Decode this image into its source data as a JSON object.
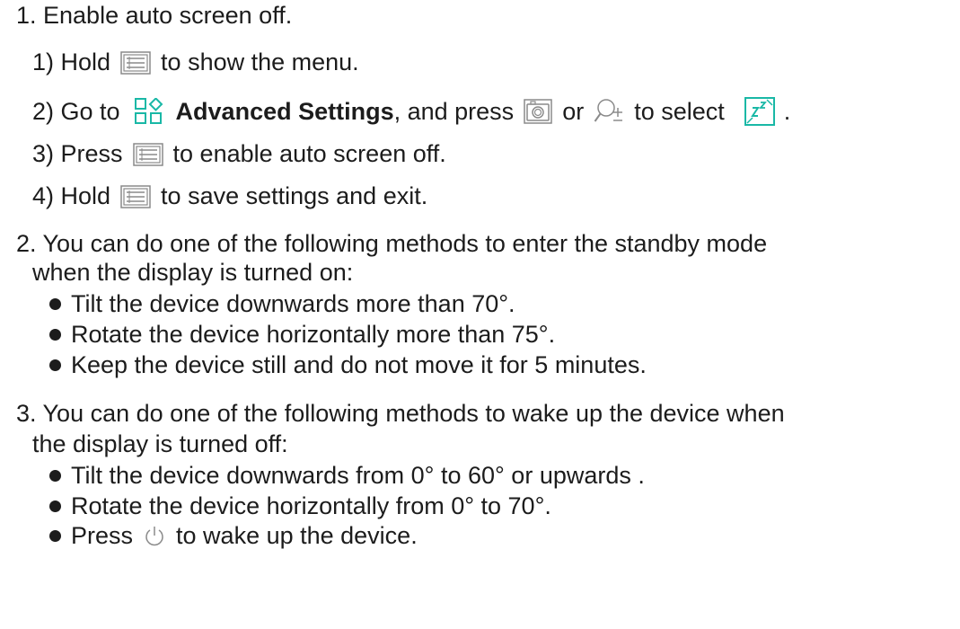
{
  "steps": [
    {
      "label": "1. Enable auto screen off.",
      "substeps": [
        {
          "prefix": "1) Hold",
          "icon": "menu-button-icon",
          "suffix": "to show the menu."
        },
        {
          "prefix": "2) Go to",
          "icon1": "advanced-settings-icon",
          "bold": "Advanced Settings",
          "mid1": ", and press",
          "icon2": "camera-button-icon",
          "mid2": "or",
          "icon3": "zoom-button-icon",
          "mid3": "to select",
          "icon4": "auto-screen-off-icon",
          "end": "."
        },
        {
          "prefix": "3) Press",
          "icon": "menu-button-icon",
          "suffix": "to enable auto screen off."
        },
        {
          "prefix": "4) Hold",
          "icon": "menu-button-icon",
          "suffix": "to save settings and exit."
        }
      ]
    },
    {
      "label_line1": "2. You can do one of the following methods to enter the standby mode",
      "label_line2": "when the display is turned on:",
      "bullets": [
        "Tilt the device downwards more than 70°.",
        "Rotate the device horizontally more than 75°.",
        "Keep the device still and do not move it for 5 minutes."
      ]
    },
    {
      "label_line1": "3. You can do one of the following methods to wake up the device when",
      "label_line2": "the display is turned off:",
      "bullets": [
        "Tilt the device downwards from 0° to 60° or upwards .",
        "Rotate the device horizontally from 0° to 70°."
      ],
      "last_bullet": {
        "prefix": "Press",
        "icon": "power-button-icon",
        "suffix": "to wake up the device."
      }
    }
  ],
  "colors": {
    "text": "#1c1c1c",
    "accent": "#19b8a6",
    "icon_gray": "#8a8a8a"
  }
}
